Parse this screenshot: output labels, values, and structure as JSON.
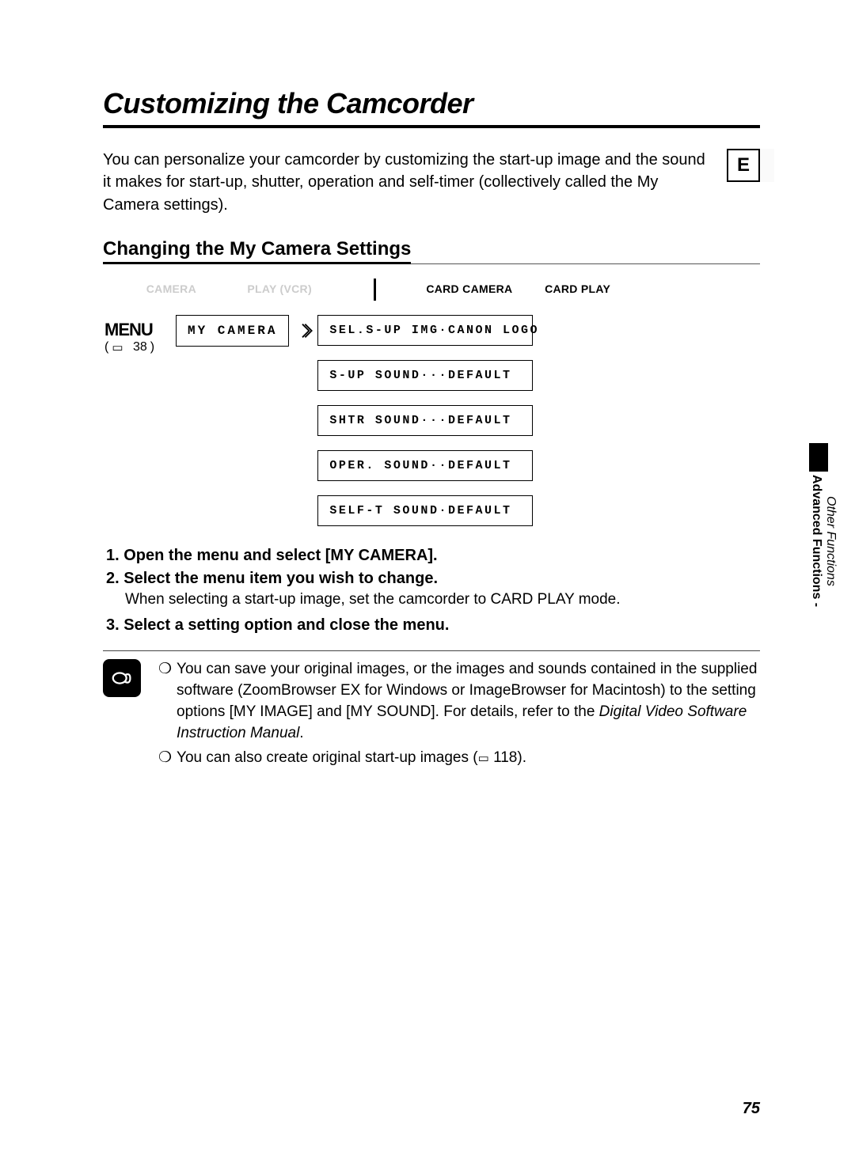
{
  "title": "Customizing the Camcorder",
  "lang_tag": "E",
  "intro": "You can personalize your camcorder by customizing the start-up image and the sound it makes for start-up, shutter, operation and self-timer (collectively called the My Camera settings).",
  "section_heading": "Changing the My Camera Settings",
  "modes": {
    "camera": "CAMERA",
    "play_vcr": "PLAY (VCR)",
    "card_camera": "CARD CAMERA",
    "card_play": "CARD PLAY"
  },
  "menu": {
    "label": "MENU",
    "ref_page": "38",
    "category": "MY CAMERA",
    "items": [
      "SEL.S-UP IMG·CANON LOGO",
      "S-UP SOUND···DEFAULT",
      "SHTR SOUND···DEFAULT",
      "OPER. SOUND··DEFAULT",
      "SELF-T SOUND·DEFAULT"
    ]
  },
  "steps": [
    {
      "num": "1.",
      "text": "Open the menu and select [MY CAMERA]."
    },
    {
      "num": "2.",
      "text": "Select the menu item you wish to change.",
      "note": "When selecting a start-up image, set the camcorder to CARD PLAY mode."
    },
    {
      "num": "3.",
      "text": "Select a setting option and close the menu."
    }
  ],
  "tips": {
    "t1_a": "You can save your original images, or the images and sounds contained in the supplied software (ZoomBrowser EX for Windows or ImageBrowser for Macintosh) to the setting options [MY IMAGE] and [MY SOUND]. For details, refer to the ",
    "t1_b": "Digital Video Software Instruction Manual",
    "t1_c": ".",
    "t2_a": "You can also create original start-up images (",
    "t2_ref": "118",
    "t2_b": ")."
  },
  "side": {
    "category": "Other Functions",
    "chapter": "Advanced Functions -"
  },
  "page_number": "75"
}
